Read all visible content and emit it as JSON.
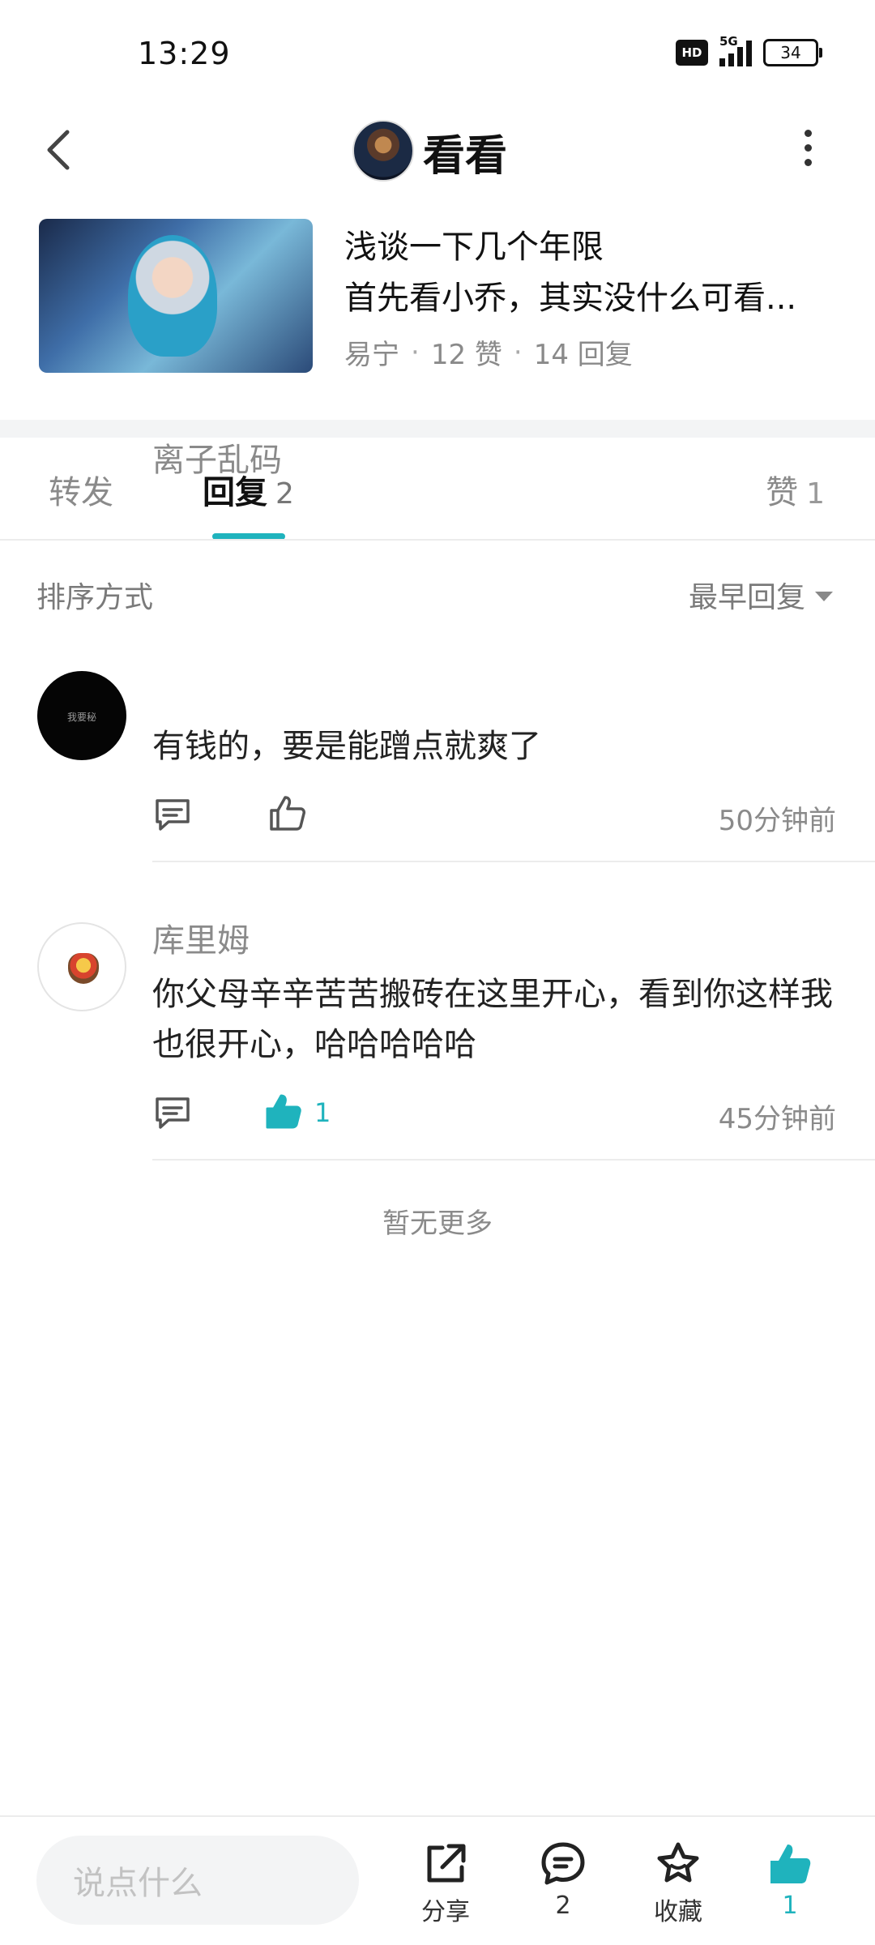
{
  "status_bar": {
    "time": "13:29",
    "network": "5G",
    "hd": "HD",
    "battery": "34"
  },
  "header": {
    "title": "看看"
  },
  "post": {
    "title": "浅谈一下几个年限",
    "excerpt": "首先看小乔，其实没什么可看...",
    "author": "易宁",
    "likes": "12 赞",
    "replies": "14 回复"
  },
  "tabs": {
    "forward": "转发",
    "reply": "回复",
    "reply_count": "2",
    "like": "赞",
    "like_count": "1"
  },
  "sort": {
    "label": "排序方式",
    "value": "最早回复"
  },
  "comments": [
    {
      "name": "离子乱码",
      "text": "有钱的，要是能蹭点就爽了",
      "likes": "",
      "time": "50分钟前",
      "liked": false
    },
    {
      "name": "库里姆",
      "text": "你父母辛辛苦苦搬砖在这里开心，看到你这样我也很开心，哈哈哈哈哈",
      "likes": "1",
      "time": "45分钟前",
      "liked": true
    }
  ],
  "footer_note": "暂无更多",
  "bottom_bar": {
    "input_placeholder": "说点什么",
    "share_label": "分享",
    "comment_count": "2",
    "favorite_label": "收藏",
    "like_count": "1"
  },
  "colors": {
    "accent": "#1fb3bd",
    "muted": "#8a8a8a",
    "band": "#f3f4f5"
  },
  "icons": [
    "back-chevron-icon",
    "more-vertical-icon",
    "comment-icon",
    "thumbs-up-icon",
    "share-icon",
    "star-icon"
  ]
}
